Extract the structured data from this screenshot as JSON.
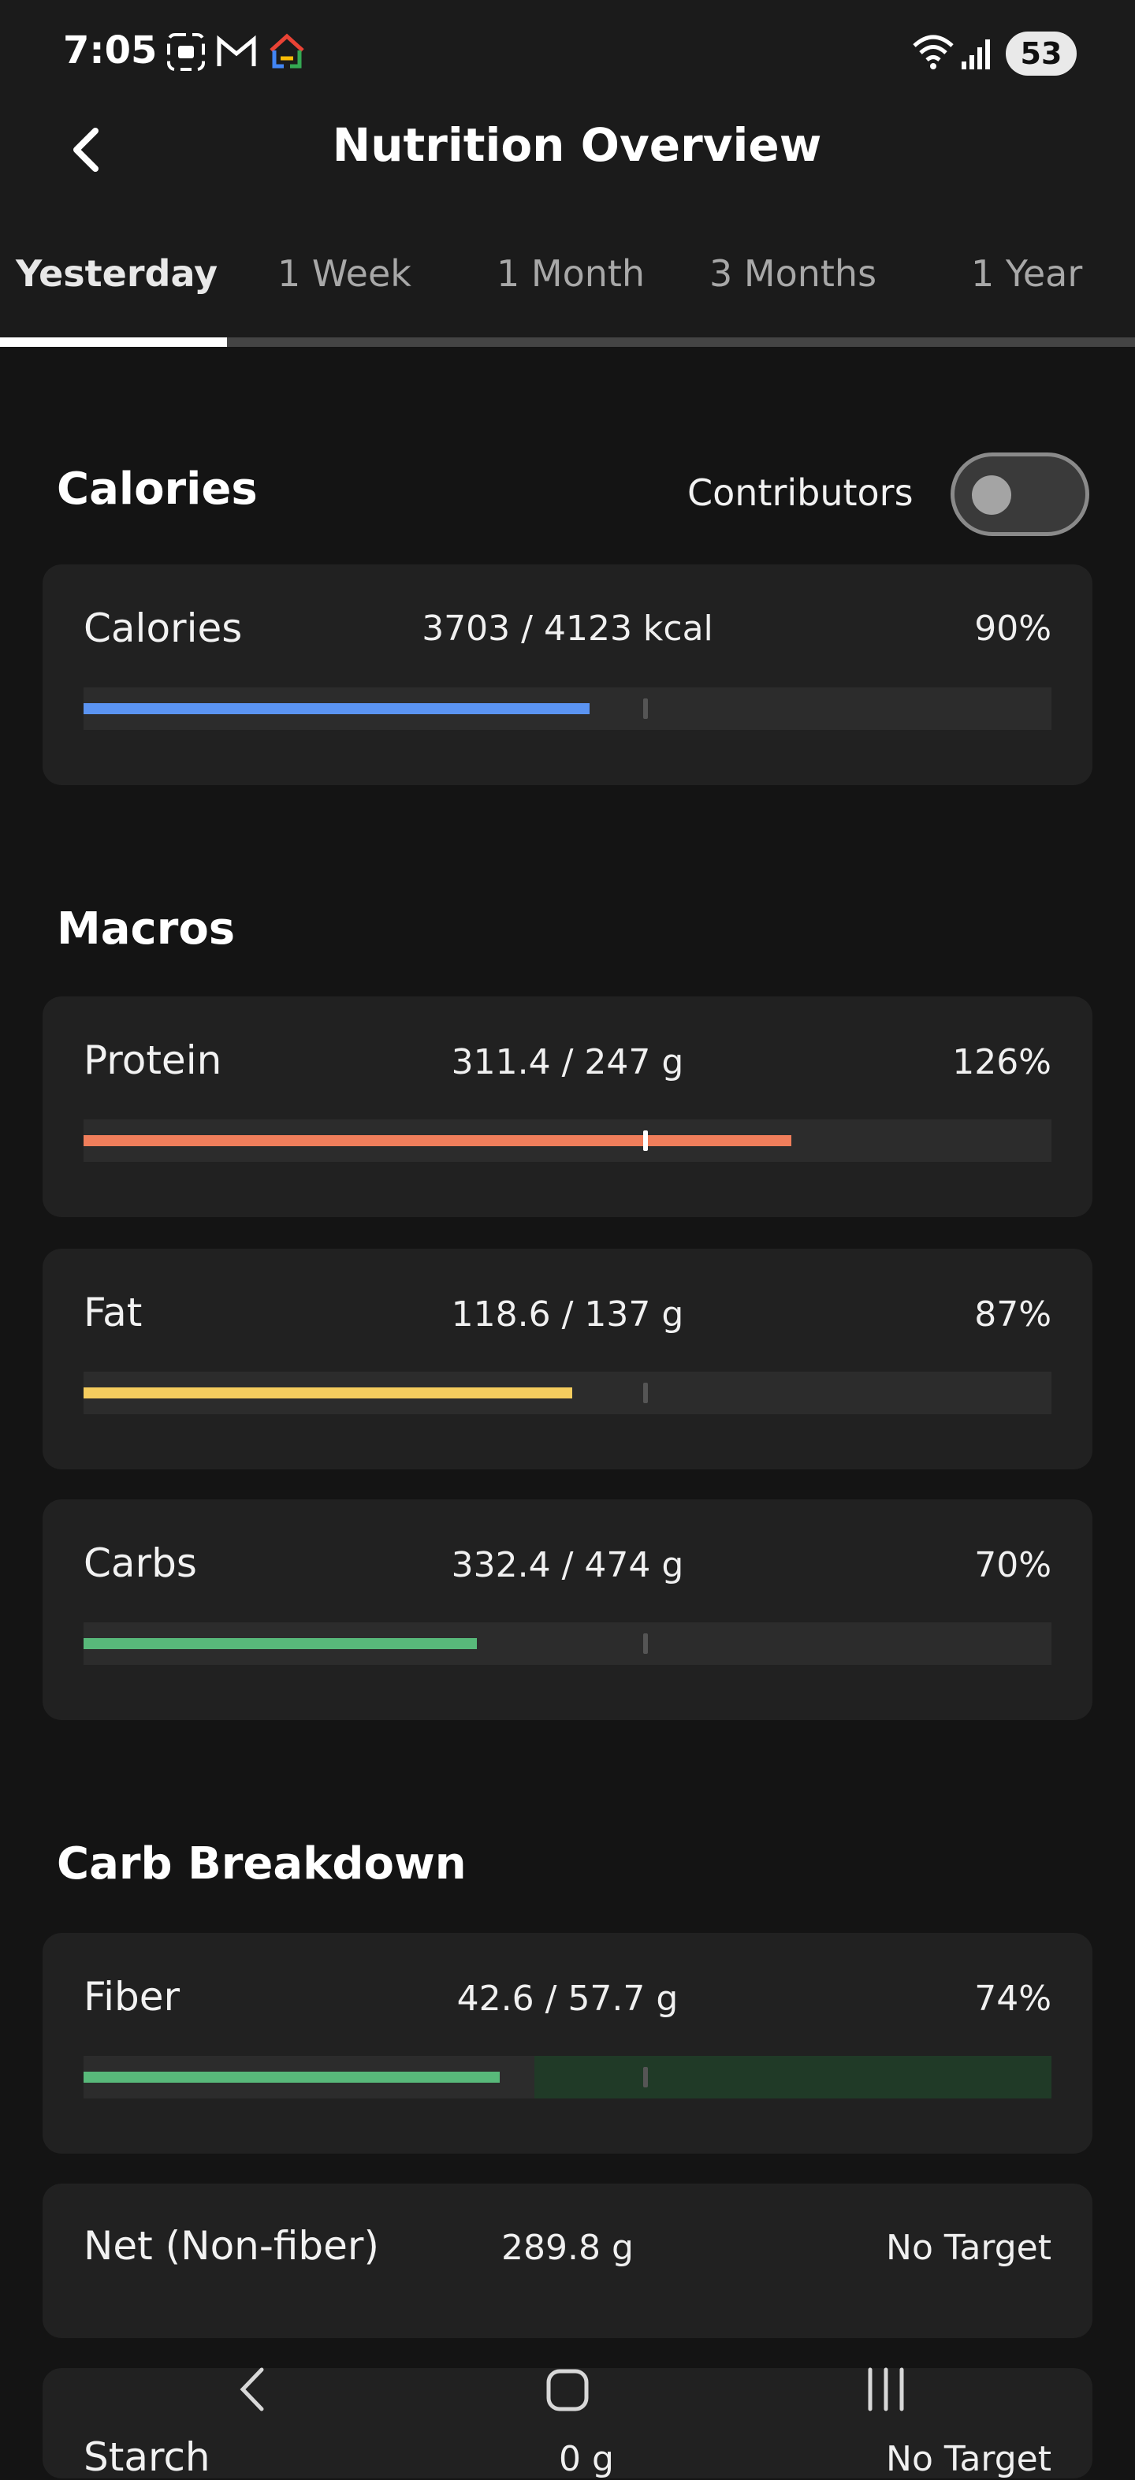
{
  "status": {
    "time": "7:05",
    "battery": "53",
    "icons": [
      "screenshot-icon",
      "gmail-icon",
      "google-home-icon",
      "wifi-icon",
      "signal-icon"
    ]
  },
  "header": {
    "title": "Nutrition Overview",
    "back_icon": "chevron-left-icon"
  },
  "tabs": [
    {
      "label": "Yesterday",
      "active": true
    },
    {
      "label": "1 Week",
      "active": false
    },
    {
      "label": "1 Month",
      "active": false
    },
    {
      "label": "3 Months",
      "active": false
    },
    {
      "label": "1 Year",
      "active": false
    }
  ],
  "calories_section": {
    "title": "Calories",
    "contributors_label": "Contributors",
    "contributors_on": false,
    "item": {
      "name": "Calories",
      "value": "3703 / 4123 kcal",
      "percent": "90%",
      "progress": 0.9,
      "color": "#5b94f2"
    }
  },
  "macros_section": {
    "title": "Macros",
    "items": [
      {
        "name": "Protein",
        "value": "311.4 / 247 g",
        "percent": "126%",
        "progress": 1.26,
        "color": "#f07e5b"
      },
      {
        "name": "Fat",
        "value": "118.6 / 137 g",
        "percent": "87%",
        "progress": 0.87,
        "color": "#f6cd5e"
      },
      {
        "name": "Carbs",
        "value": "332.4 / 474 g",
        "percent": "70%",
        "progress": 0.7,
        "color": "#58b97a"
      }
    ]
  },
  "carb_section": {
    "title": "Carb Breakdown",
    "fiber": {
      "name": "Fiber",
      "value": "42.6 / 57.7 g",
      "percent": "74%",
      "progress": 0.74,
      "color": "#58b97a",
      "range_color": "#203a27"
    },
    "net": {
      "name": "Net (Non-fiber)",
      "value": "289.8 g",
      "target": "No Target"
    },
    "starch": {
      "name": "Starch",
      "value": "0 g",
      "target": "No Target"
    }
  },
  "navbar": {
    "back_icon": "nav-back-icon",
    "home_icon": "nav-home-icon",
    "recents_icon": "nav-recents-icon"
  },
  "colors": {
    "background": "#141414",
    "card": "#212121",
    "track": "#2c2c2c"
  }
}
